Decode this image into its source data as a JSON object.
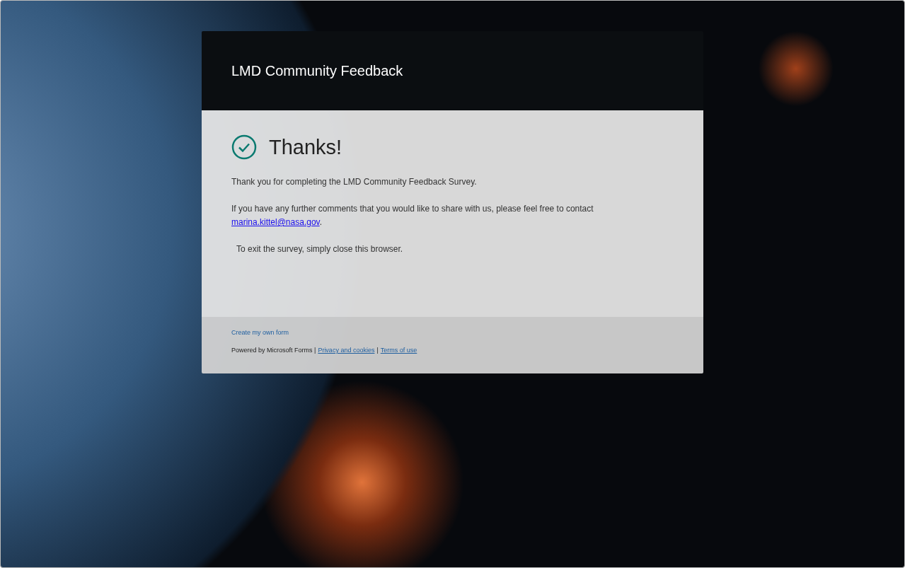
{
  "form": {
    "title": "LMD Community Feedback"
  },
  "confirmation": {
    "heading": "Thanks!",
    "message": "Thank you for completing the LMD Community Feedback Survey.",
    "contact_text": "If you have any further comments that you would like to share with us, please feel free to contact",
    "contact_email": "marina.kittel@nasa.gov",
    "contact_end": ".",
    "exit_note": "To exit the survey, simply close this browser."
  },
  "footer": {
    "create_link": "Create my own form",
    "powered_by": "Powered by Microsoft Forms |",
    "links": [
      {
        "label": "Privacy and cookies"
      },
      {
        "label": "Terms of use"
      }
    ],
    "separator": "|"
  }
}
